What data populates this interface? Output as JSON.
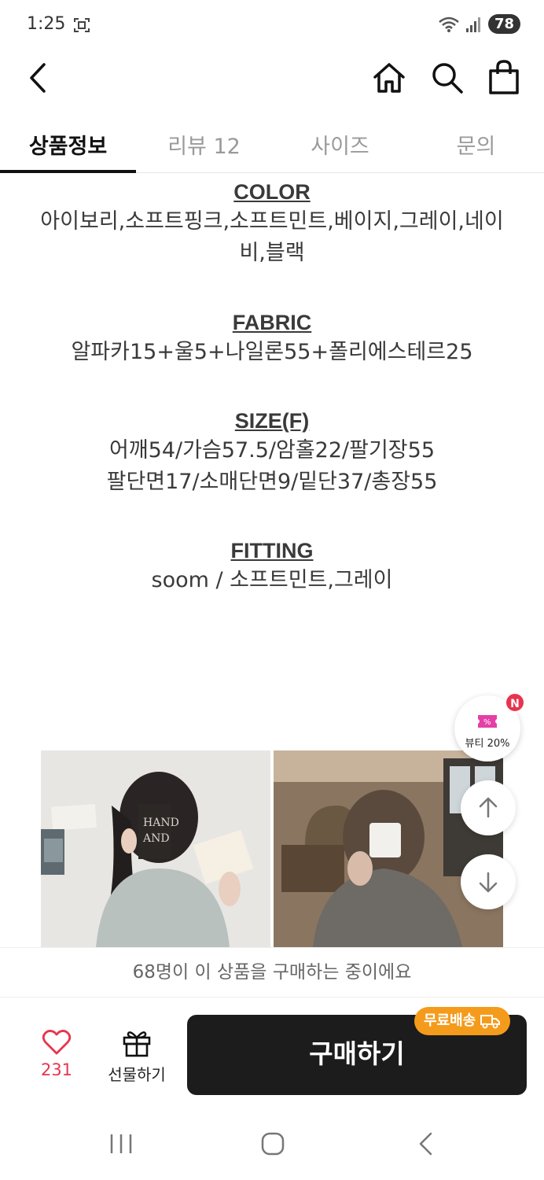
{
  "status_bar": {
    "time": "1:25",
    "battery": "78",
    "icons": [
      "screenshot-icon",
      "wifi-icon",
      "signal-icon",
      "battery-icon"
    ]
  },
  "header": {
    "icons": [
      "back-arrow-icon",
      "home-icon",
      "search-icon",
      "shopping-bag-icon"
    ]
  },
  "tabs": [
    {
      "label": "상품정보",
      "active": true
    },
    {
      "label": "리뷰 12",
      "active": false
    },
    {
      "label": "사이즈",
      "active": false
    },
    {
      "label": "문의",
      "active": false
    }
  ],
  "product_info": {
    "color": {
      "title": "COLOR",
      "lines": [
        "아이보리,소프트핑크,소프트민트,베이지,그레이,네이",
        "비,블랙"
      ]
    },
    "fabric": {
      "title": "FABRIC",
      "lines": [
        "알파카15+울5+나일론55+폴리에스테르25"
      ]
    },
    "size": {
      "title": "SIZE(F)",
      "lines": [
        "어깨54/가슴57.5/암홀22/팔기장55",
        "팔단면17/소매단면9/밑단37/총장55"
      ]
    },
    "fitting": {
      "title": "FITTING",
      "lines": [
        "soom / 소프트민트,그레이"
      ]
    }
  },
  "photos": {
    "left_card_text": "HAND",
    "left_card_text_2": "AND"
  },
  "floating": {
    "beauty_label": "뷰티 20%",
    "badge": "N"
  },
  "buying_banner": "68명이 이 상품을 구매하는 중이에요",
  "action_bar": {
    "like_count": "231",
    "gift_label": "선물하기",
    "buy_label": "구매하기",
    "free_shipping": "무료배송"
  },
  "colors": {
    "accent_red": "#e8344e",
    "buy_button": "#1c1c1c",
    "free_ship": "#f59b1b"
  }
}
